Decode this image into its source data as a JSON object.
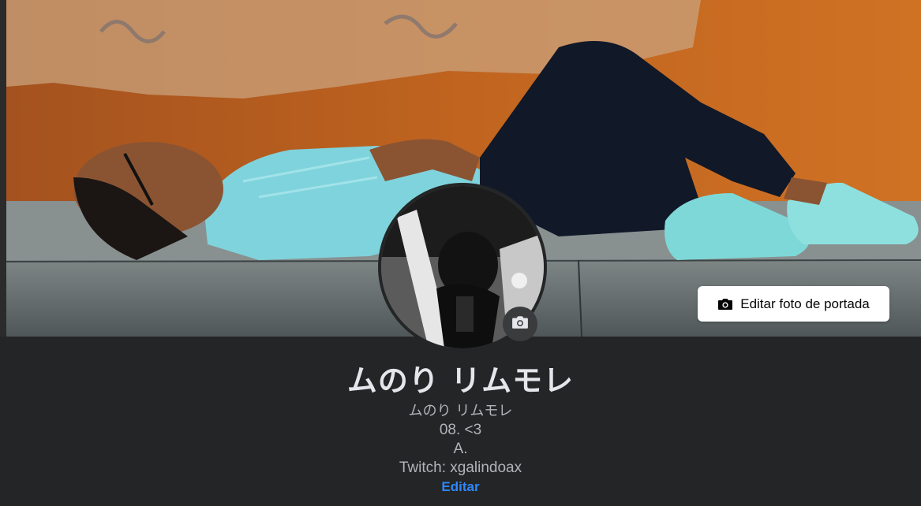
{
  "cover": {
    "edit_button_label": "Editar foto de portada",
    "edit_button_icon": "camera-icon"
  },
  "profile": {
    "name": "ムのり リムモレ",
    "avatar_camera_icon": "camera-icon"
  },
  "bio": {
    "lines": [
      "ムのり リムモレ",
      "08. <3",
      "A.",
      "Twitch: xgalindoax"
    ],
    "edit_label": "Editar"
  },
  "colors": {
    "background": "#242526",
    "name_text": "#e4e6eb",
    "bio_text": "#b0b3b8",
    "link": "#2d88ff",
    "cover_wall": "#b65a1c"
  }
}
